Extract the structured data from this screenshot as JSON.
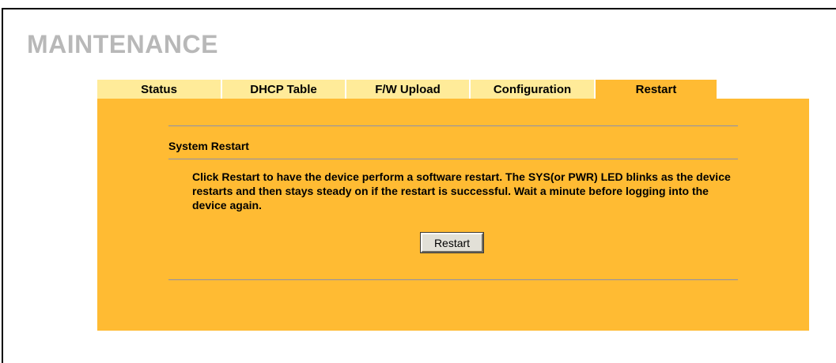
{
  "page": {
    "title": "MAINTENANCE"
  },
  "tabs": [
    {
      "label": "Status",
      "active": false
    },
    {
      "label": "DHCP Table",
      "active": false
    },
    {
      "label": "F/W Upload",
      "active": false
    },
    {
      "label": "Configuration",
      "active": false
    },
    {
      "label": "Restart",
      "active": true
    }
  ],
  "system_restart": {
    "heading": "System Restart",
    "description": "Click Restart to have the device perform a software restart. The SYS(or PWR) LED blinks as the device restarts and then stays steady on if the restart is successful. Wait a minute before logging into the device again.",
    "button_label": "Restart"
  },
  "colors": {
    "panel": "#ffbb33",
    "tab_inactive": "#ffeb99",
    "rule": "#8b8fae",
    "title": "#b8b8b8"
  }
}
